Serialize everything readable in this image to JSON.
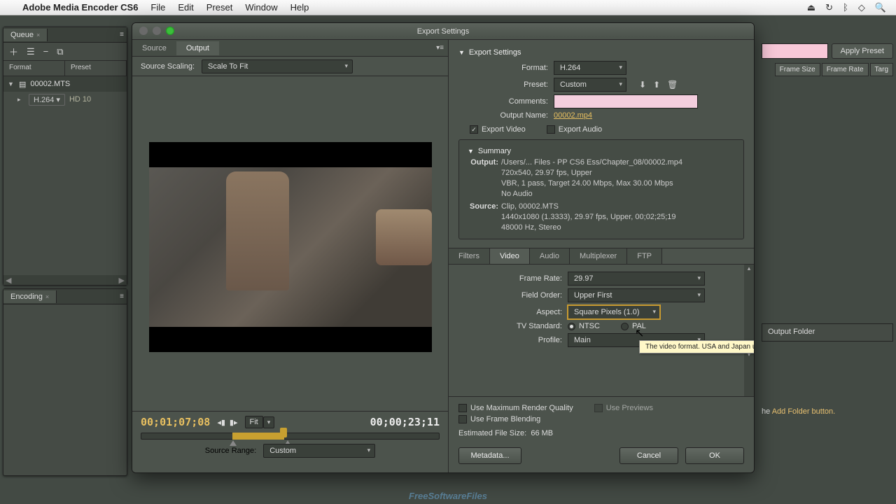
{
  "menubar": {
    "app_name": "Adobe Media Encoder CS6",
    "items": [
      "File",
      "Edit",
      "Preset",
      "Window",
      "Help"
    ]
  },
  "queue": {
    "tab": "Queue",
    "cols": [
      "Format",
      "Preset"
    ],
    "item_name": "00002.MTS",
    "item_format": "H.264",
    "item_preset": "HD 10"
  },
  "encoding": {
    "tab": "Encoding"
  },
  "right": {
    "apply_preset": "Apply Preset",
    "headers": [
      "Frame Size",
      "Frame Rate",
      "Targ"
    ],
    "output_folder": "Output Folder",
    "add_folder_hint_pre": "he ",
    "add_folder_hint_hi": "Add Folder button."
  },
  "dialog": {
    "title": "Export Settings",
    "tabs": {
      "source": "Source",
      "output": "Output"
    },
    "source_scaling_label": "Source Scaling:",
    "source_scaling_value": "Scale To Fit",
    "timecode_in": "00;01;07;08",
    "timecode_dur": "00;00;23;11",
    "fit": "Fit",
    "source_range_label": "Source Range:",
    "source_range_value": "Custom"
  },
  "export": {
    "header": "Export Settings",
    "format_label": "Format:",
    "format_value": "H.264",
    "preset_label": "Preset:",
    "preset_value": "Custom",
    "comments_label": "Comments:",
    "output_name_label": "Output Name:",
    "output_name": "00002.mp4",
    "export_video": "Export Video",
    "export_audio": "Export Audio",
    "summary_header": "Summary",
    "summary_output_label": "Output:",
    "summary_output_1": "/Users/... Files - PP CS6 Ess/Chapter_08/00002.mp4",
    "summary_output_2": "720x540, 29.97 fps, Upper",
    "summary_output_3": "VBR, 1 pass, Target 24.00 Mbps, Max 30.00 Mbps",
    "summary_output_4": "No Audio",
    "summary_source_label": "Source:",
    "summary_source_1": "Clip, 00002.MTS",
    "summary_source_2": "1440x1080 (1.3333), 29.97 fps, Upper, 00;02;25;19",
    "summary_source_3": "48000 Hz, Stereo"
  },
  "tabs2": [
    "Filters",
    "Video",
    "Audio",
    "Multiplexer",
    "FTP"
  ],
  "video": {
    "frame_rate_label": "Frame Rate:",
    "frame_rate": "29.97",
    "field_order_label": "Field Order:",
    "field_order": "Upper First",
    "aspect_label": "Aspect:",
    "aspect": "Square Pixels (1.0)",
    "tv_label": "TV Standard:",
    "tv_ntsc": "NTSC",
    "tv_pal": "PAL",
    "profile_label": "Profile:",
    "profile": "Main",
    "tooltip": "The video format. USA and Japan use NTSC. Europe and Asia use PAL."
  },
  "bottom": {
    "max_quality": "Use Maximum Render Quality",
    "previews": "Use Previews",
    "frame_blending": "Use Frame Blending",
    "est_label": "Estimated File Size:",
    "est_value": "66 MB",
    "metadata": "Metadata...",
    "cancel": "Cancel",
    "ok": "OK"
  },
  "watermark": "FreeSoftwareFiles"
}
